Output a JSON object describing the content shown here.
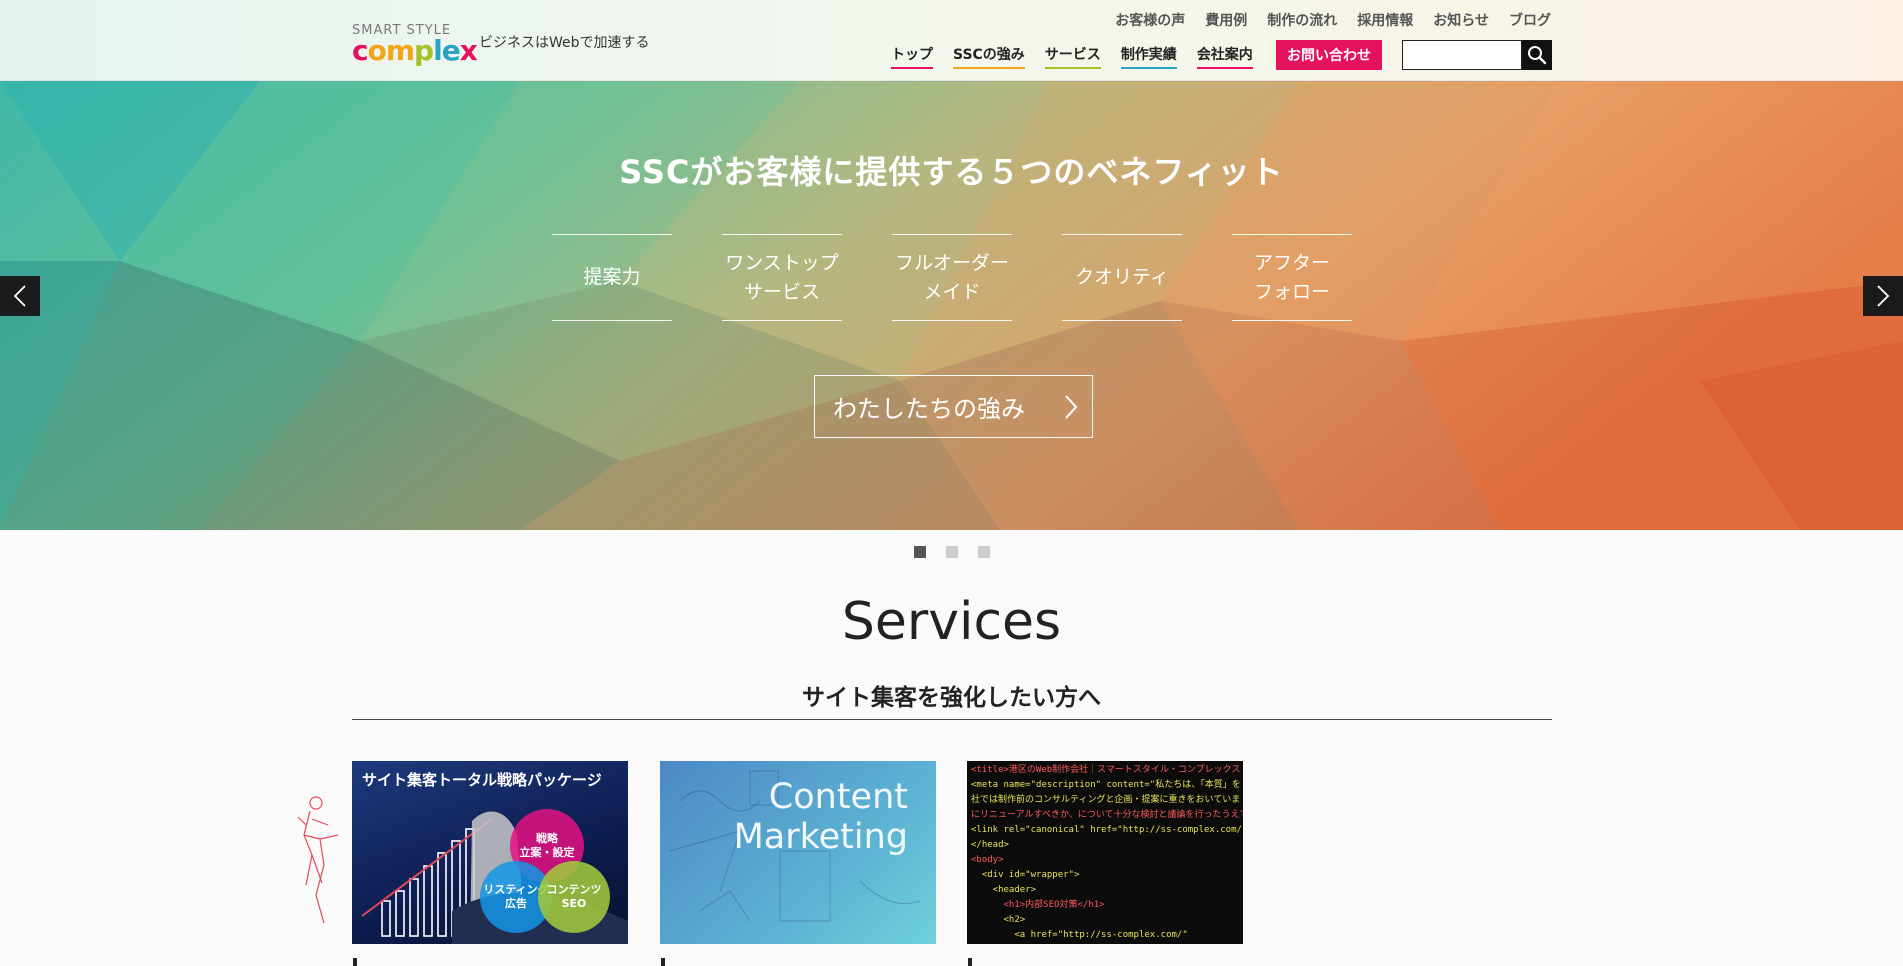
{
  "header": {
    "logo_top": "SMART STYLE",
    "logo_letters": [
      "c",
      "o",
      "m",
      "p",
      "l",
      "e",
      "x"
    ],
    "tagline": "ビジネスはWebで加速する",
    "subnav": [
      "お客様の声",
      "費用例",
      "制作の流れ",
      "採用情報",
      "お知らせ",
      "ブログ"
    ],
    "mainnav": [
      {
        "label": "トップ",
        "color": "#e4125f"
      },
      {
        "label": "SSCの強み",
        "color": "#f2a516"
      },
      {
        "label": "サービス",
        "color": "#a6c227"
      },
      {
        "label": "制作実績",
        "color": "#2ba3c4"
      },
      {
        "label": "会社案内",
        "color": "#e4125f"
      }
    ],
    "contact": "お問い合わせ",
    "search_placeholder": ""
  },
  "hero": {
    "title": "SSCがお客様に提供する５つのベネフィット",
    "benefits": [
      "提案力",
      "ワンストップ\nサービス",
      "フルオーダー\nメイド",
      "クオリティ",
      "アフター\nフォロー"
    ],
    "cta": "わたしたちの強み",
    "active_slide": 1,
    "slides": 3
  },
  "services": {
    "title": "Services",
    "subtitle": "サイト集客を強化したい方へ",
    "cards": [
      {
        "banner": "サイト集客トータル戦略パッケージ",
        "circles": [
          "戦略\n立案・設定",
          "リスティング\n広告",
          "コンテンツ\nSEO"
        ]
      },
      {
        "text": "Content\nMarketing"
      },
      {
        "code": [
          "<title>港区のWeb制作会社｜スマートスタイル・コンプレックス",
          "<meta name=\"description\" content=\"私たちは、「本質」を",
          "社では制作前のコンサルティングと企画・提案に重きをおいていま",
          "にリニューアルすべきか、について十分な検討と議論を行ったうえで",
          "<link rel=\"canonical\" href=\"http://ss-complex.com/\" />",
          "</head>",
          "<body>",
          "  <div id=\"wrapper\">",
          "    <header>",
          "      <h1>内部SEO対策</h1>",
          "      <h2>",
          "        <a href=\"http://ss-complex.com/\""
        ]
      }
    ]
  },
  "colors": {
    "accent": "#e4125f",
    "logo": [
      "#e4125f",
      "#f2a516",
      "#f2a516",
      "#a6c227",
      "#2ba3c4",
      "#2ba3c4",
      "#e4125f"
    ]
  }
}
